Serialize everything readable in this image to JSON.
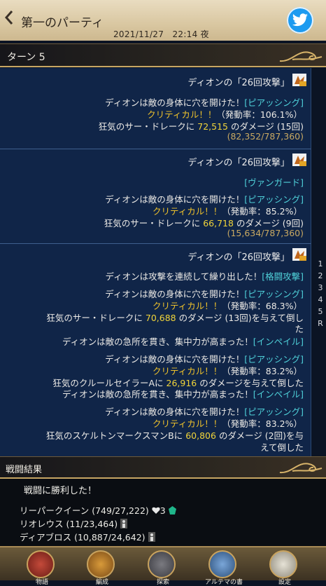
{
  "header": {
    "back_icon": "chevron-left-icon",
    "title": "第一のパーティ",
    "datetime": "2021/11/27　22:14 夜",
    "share_icon": "twitter-bird-icon"
  },
  "turn": {
    "label": "ターン 5"
  },
  "side_tabs": [
    "1",
    "2",
    "3",
    "4",
    "5",
    "R"
  ],
  "log": {
    "b1": {
      "head": "ディオンの「26回攻撃」",
      "l1a": "ディオンは敵の身体に穴を開けた！",
      "l1b": "[ピアッシング]",
      "l2a": "クリティカル！！",
      "l2b": "（発動率：106.1%）",
      "l3a": "狂気のサー・ドレークに",
      "l3b": "72,515",
      "l3c": "のダメージ (15回)",
      "l4": "(82,352/787,360)"
    },
    "b2": {
      "head": "ディオンの「26回攻撃」",
      "l1": "[ヴァンガード]",
      "l2a": "ディオンは敵の身体に穴を開けた！",
      "l2b": "[ピアッシング]",
      "l3a": "クリティカル！！",
      "l3b": "（発動率：85.2%）",
      "l4a": "狂気のサー・ドレークに",
      "l4b": "66,718",
      "l4c": "のダメージ (9回)",
      "l5": "(15,634/787,360)"
    },
    "b3": {
      "head": "ディオンの「26回攻撃」",
      "l1a": "ディオンは攻撃を連続して繰り出した！",
      "l1b": "[格闘攻撃]",
      "l2a": "ディオンは敵の身体に穴を開けた！",
      "l2b": "[ピアッシング]",
      "l3a": "クリティカル！！",
      "l3b": "（発動率：68.3%）",
      "l4a": "狂気のサー・ドレークに",
      "l4b": "70,688",
      "l4c": "のダメージ (13回)を与えて倒し",
      "l5": "た",
      "l6a": "ディオンは敵の急所を貫き、集中力が高まった！",
      "l6b": "[インペイル]",
      "l7a": "ディオンは敵の身体に穴を開けた！",
      "l7b": "[ピアッシング]",
      "l8a": "クリティカル！！",
      "l8b": "（発動率：83.2%）",
      "l9a": "狂気のクルールセイラーAに",
      "l9b": "26,916",
      "l9c": "のダメージを与えて倒した",
      "l10a": "ディオンは敵の急所を貫き、集中力が高まった！",
      "l10b": "[インペイル]",
      "l11a": "ディオンは敵の身体に穴を開けた！",
      "l11b": "[ピアッシング]",
      "l12a": "クリティカル！！",
      "l12b": "（発動率：83.2%）",
      "l13a": "狂気のスケルトンマークスマンBに",
      "l13b": "60,806",
      "l13c": "のダメージ (2回)を与",
      "l14": "えて倒した"
    }
  },
  "result": {
    "label": "戦闘結果",
    "victory": "戦闘に勝利した！",
    "members": [
      {
        "text": "リーパークイーン (749/27,222)",
        "extra": "3"
      },
      {
        "text": "リオレウス (11/23,464)"
      },
      {
        "text": "ディアブロス (10,887/24,642)"
      }
    ]
  },
  "nav": [
    "物語",
    "編成",
    "探索",
    "アルテマの書",
    "設定"
  ],
  "colors": {
    "accent": "#c7a663",
    "cyan": "#4fd1d9",
    "gold": "#efc22b",
    "panel": "#102548"
  }
}
